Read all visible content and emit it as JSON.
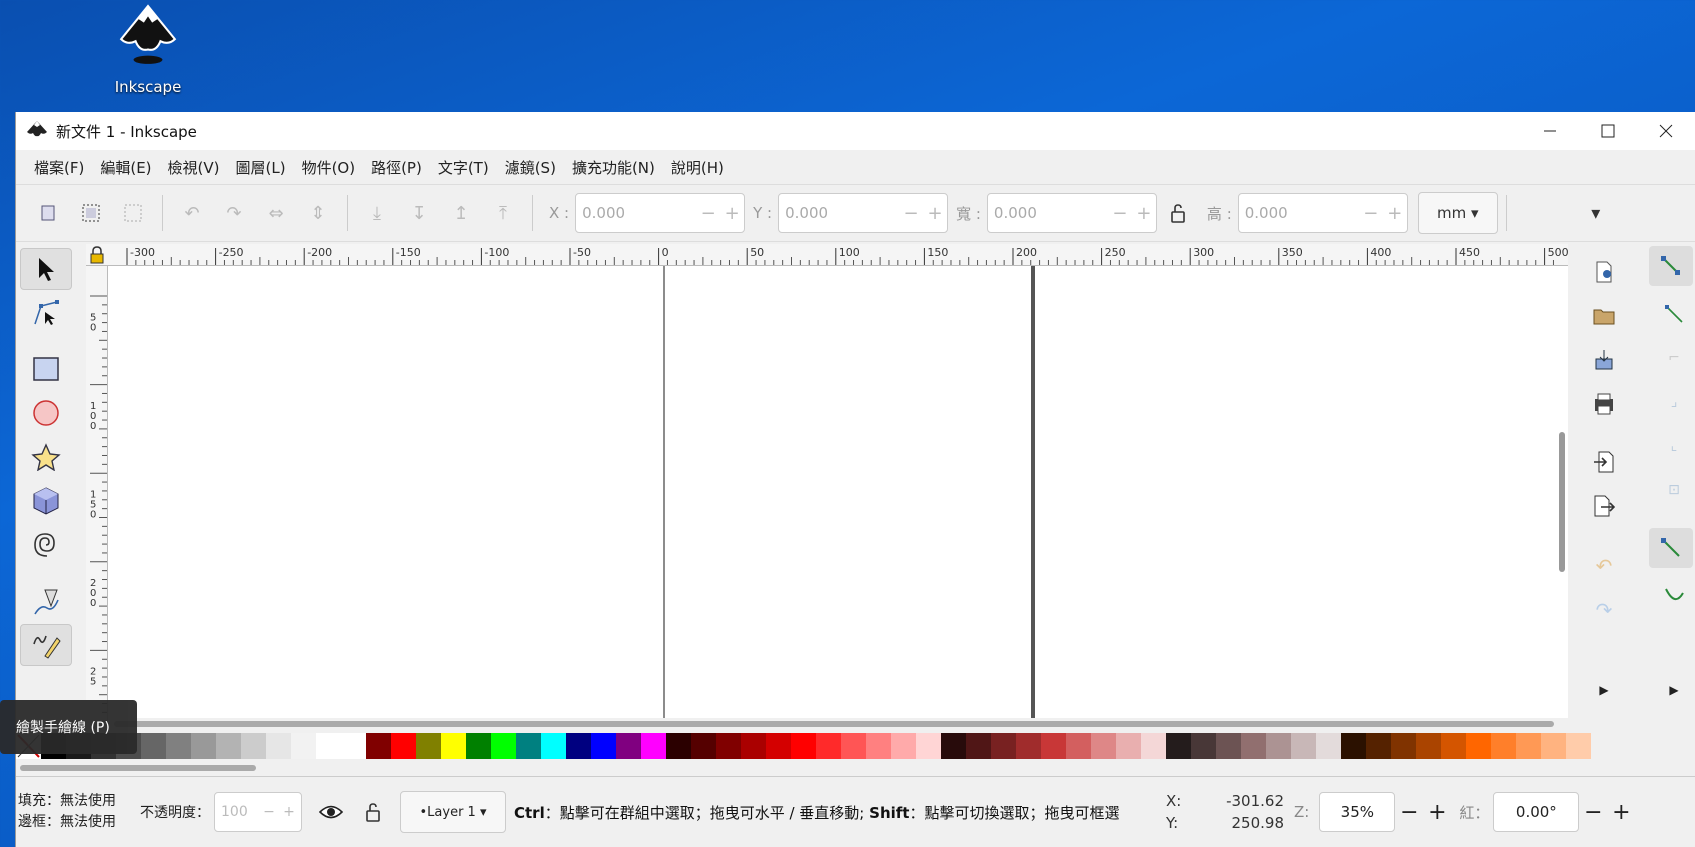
{
  "desktop": {
    "icon_label": "Inkscape"
  },
  "window": {
    "title": "新文件 1 - Inkscape"
  },
  "menu": [
    "檔案(F)",
    "編輯(E)",
    "檢視(V)",
    "圖層(L)",
    "物件(O)",
    "路徑(P)",
    "文字(T)",
    "濾鏡(S)",
    "擴充功能(N)",
    "說明(H)"
  ],
  "toolbar": {
    "x_label": "X :",
    "x_value": "0.000",
    "y_label": "Y :",
    "y_value": "0.000",
    "w_label": "寬 :",
    "w_value": "0.000",
    "h_label": "高 :",
    "h_value": "0.000",
    "unit": "mm"
  },
  "ruler_top_labels": [
    "-300",
    "-250",
    "-200",
    "-150",
    "-100",
    "-50",
    "0",
    "50",
    "100",
    "150",
    "200",
    "250",
    "300",
    "350",
    "400",
    "450",
    "500"
  ],
  "ruler_left_labels": [
    "5 0",
    "1 0 0",
    "1 5 0",
    "2 0 0",
    "2 5"
  ],
  "tooltip": "繪製手繪線 (P)",
  "status": {
    "fill_label": "填充：",
    "fill_value": "無法使用",
    "stroke_label": "邊框：",
    "stroke_value": "無法使用",
    "opacity_label": "不透明度：",
    "opacity_value": "100",
    "layer": "•Layer 1",
    "message_ctrl": "Ctrl",
    "message_1": "：點擊可在群組中選取；拖曳可水平 / 垂直移動; ",
    "message_shift": "Shift",
    "message_2": "：點擊可切換選取；拖曳可框選",
    "x_label": "X:",
    "x_value": "-301.62",
    "y_label": "Y:",
    "y_value": "250.98",
    "zoom_label": "Z:",
    "zoom_value": "35%",
    "rotate_label": "紅：",
    "rotate_value": "0.00°"
  },
  "palette": [
    "#000000",
    "#1a1a1a",
    "#333333",
    "#4d4d4d",
    "#666666",
    "#808080",
    "#999999",
    "#b3b3b3",
    "#cccccc",
    "#e6e6e6",
    "#f2f2f2",
    "#ffffff",
    "#ffffff",
    "#800000",
    "#ff0000",
    "#808000",
    "#ffff00",
    "#008000",
    "#00ff00",
    "#008080",
    "#00ffff",
    "#000080",
    "#0000ff",
    "#800080",
    "#ff00ff",
    "#2b0000",
    "#550000",
    "#800000",
    "#aa0000",
    "#d40000",
    "#ff0000",
    "#ff2a2a",
    "#ff5555",
    "#ff8080",
    "#ffaaaa",
    "#ffd5d5",
    "#280b0b",
    "#501616",
    "#782121",
    "#a02c2c",
    "#c83737",
    "#d35f5f",
    "#de8787",
    "#e9afaf",
    "#f4d7d7",
    "#241c1c",
    "#483737",
    "#6c5353",
    "#916f6f",
    "#ac9393",
    "#c8b7b7",
    "#e3dbdb",
    "#2b1100",
    "#552200",
    "#803300",
    "#aa4400",
    "#d45500",
    "#ff6600",
    "#ff7f2a",
    "#ff9955",
    "#ffb380",
    "#ffccaa"
  ]
}
